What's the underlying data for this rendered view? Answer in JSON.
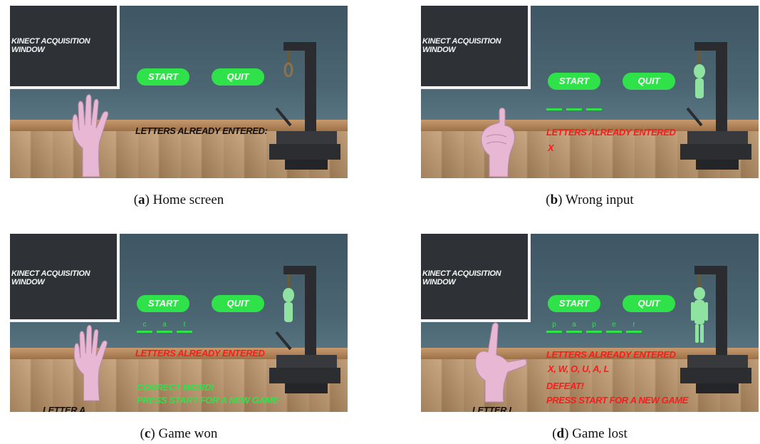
{
  "panels": [
    {
      "kinect_label": "KINECT ACQUISITION WINDOW",
      "start_label": "START",
      "quit_label": "QUIT",
      "letters_title": "LETTERS ALREADY ENTERED:",
      "letters_value": "",
      "word": [],
      "messages": [],
      "bottom_label": "",
      "caption_letter": "a",
      "caption_text": "Home screen"
    },
    {
      "kinect_label": "KINECT ACQUISITION WINDOW",
      "start_label": "START",
      "quit_label": "QUIT",
      "letters_title": "LETTERS ALREADY ENTERED",
      "letters_value": "X",
      "word": [
        "",
        "",
        ""
      ],
      "messages": [],
      "bottom_label": "",
      "caption_letter": "b",
      "caption_text": "Wrong input"
    },
    {
      "kinect_label": "KINECT ACQUISITION WINDOW",
      "start_label": "START",
      "quit_label": "QUIT",
      "letters_title": "LETTERS ALREADY ENTERED",
      "letters_value": "",
      "word": [
        "c",
        "a",
        "t"
      ],
      "messages": [
        "CORRECT WORD!",
        "PRESS START FOR A NEW GAME"
      ],
      "bottom_label": "LETTER A",
      "caption_letter": "c",
      "caption_text": "Game won"
    },
    {
      "kinect_label": "KINECT ACQUISITION WINDOW",
      "start_label": "START",
      "quit_label": "QUIT",
      "letters_title": "LETTERS ALREADY ENTERED",
      "letters_value": "X, W, O, U, A, L",
      "word": [
        "p",
        "a",
        "p",
        "e",
        "r"
      ],
      "messages": [
        "DEFEAT!",
        "PRESS START FOR A NEW GAME"
      ],
      "bottom_label": "LETTER L",
      "caption_letter": "d",
      "caption_text": "Game lost"
    }
  ],
  "colors": {
    "button": "#2fe24a",
    "title_black": "#111111",
    "title_red": "#ff1a1a",
    "win_green": "#2fe24a",
    "loss_red": "#ff1a1a"
  }
}
